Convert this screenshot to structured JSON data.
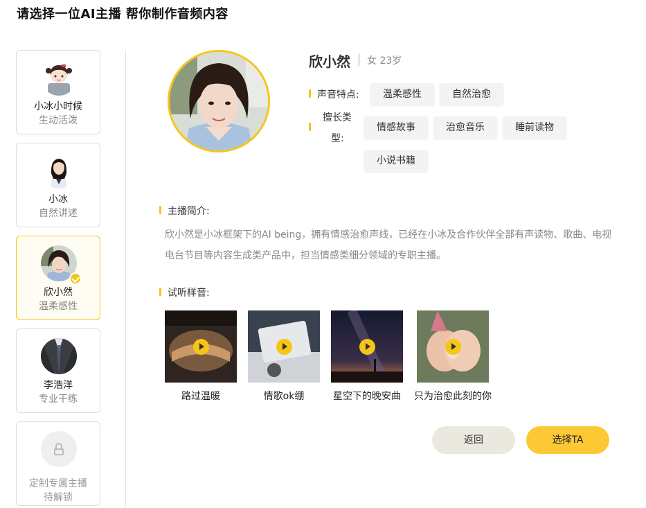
{
  "page": {
    "title": "请选择一位AI主播 帮你制作音频内容"
  },
  "sidebar": {
    "hosts": [
      {
        "name": "小冰小时候",
        "desc": "生动活泼"
      },
      {
        "name": "小冰",
        "desc": "自然讲述"
      },
      {
        "name": "欣小然",
        "desc": "温柔感性"
      },
      {
        "name": "李浩洋",
        "desc": "专业干练"
      }
    ],
    "custom": {
      "name": "定制专属主播",
      "desc": "待解锁"
    }
  },
  "detail": {
    "name": "欣小然",
    "meta": "女 23岁",
    "voice_label": "声音特点:",
    "voice_tags": [
      "温柔感性",
      "自然治愈"
    ],
    "genre_label_1": "擅长类",
    "genre_label_2": "型:",
    "genre_tags": [
      "情感故事",
      "治愈音乐",
      "睡前读物",
      "小说书籍"
    ],
    "intro_label": "主播简介:",
    "intro_text": "欣小然是小冰框架下的AI being，拥有情感治愈声线，已经在小冰及合作伙伴全部有声读物、歌曲、电视电台节目等内容生成类产品中，担当情感类细分领域的专职主播。",
    "samples_label": "试听样音:",
    "samples": [
      "路过温暖",
      "情歌ok绷",
      "星空下的晚安曲",
      "只为治愈此刻的你"
    ]
  },
  "buttons": {
    "back": "返回",
    "select": "选择TA"
  },
  "colors": {
    "accent": "#f5c518",
    "button_primary": "#fcc934",
    "button_secondary": "#ebe8df"
  }
}
